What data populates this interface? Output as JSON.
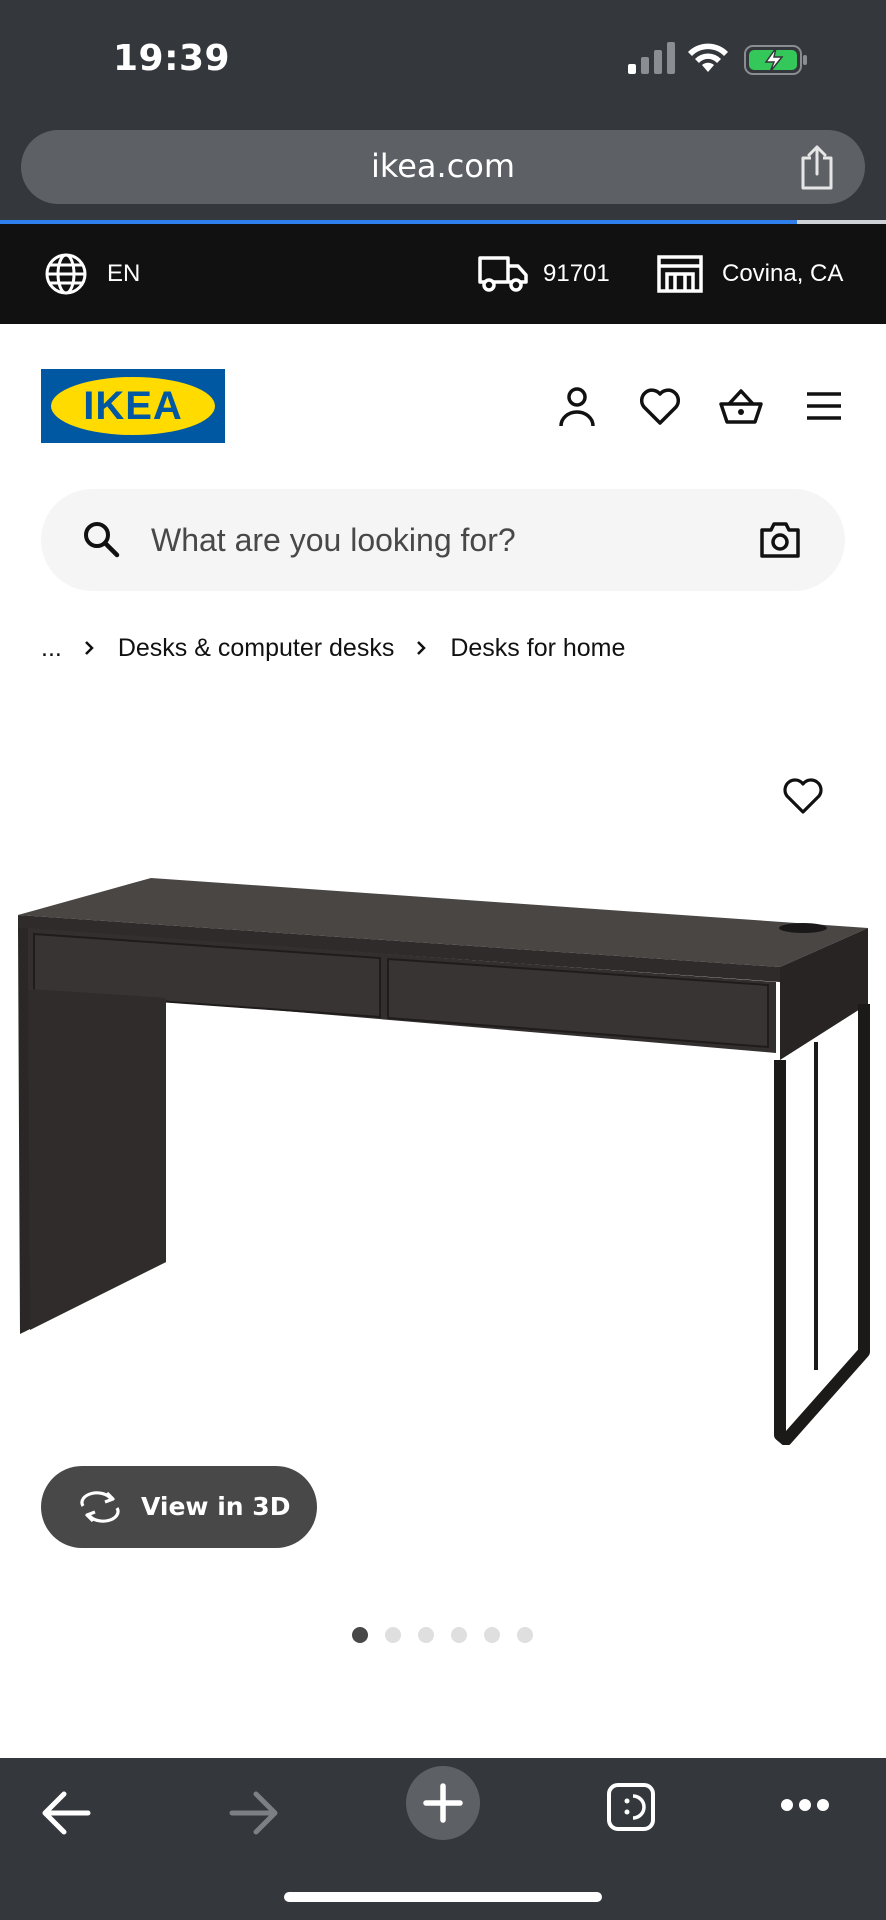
{
  "status_bar": {
    "time": "19:39"
  },
  "browser": {
    "url": "ikea.com",
    "load_progress": 0.9,
    "accent": "#2f80ed"
  },
  "utility_bar": {
    "language": "EN",
    "zip": "91701",
    "store": "Covina, CA"
  },
  "header": {
    "logo_text": "IKEA",
    "brand_blue": "#0058a3",
    "brand_yellow": "#ffdb00",
    "icons": [
      "user-icon",
      "heart-icon",
      "basket-icon",
      "menu-icon"
    ]
  },
  "search": {
    "placeholder": "What are you looking for?"
  },
  "breadcrumb": {
    "ellipsis": "...",
    "items": [
      "Desks & computer desks",
      "Desks for home"
    ]
  },
  "product": {
    "view3d_label": "View in 3D",
    "carousel": {
      "count": 6,
      "active_index": 0
    }
  },
  "toolbar": {
    "icons": [
      "back-icon",
      "forward-icon",
      "new-tab-icon",
      "tabs-icon",
      "more-icon"
    ]
  }
}
